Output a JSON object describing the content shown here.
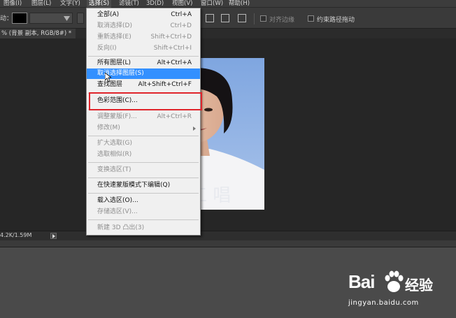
{
  "menubar": {
    "items": [
      {
        "label": "图像(I)"
      },
      {
        "label": "图层(L)"
      },
      {
        "label": "文字(Y)"
      },
      {
        "label": "选择(S)"
      },
      {
        "label": "滤镜(T)"
      },
      {
        "label": "3D(D)"
      },
      {
        "label": "视图(V)"
      },
      {
        "label": "窗口(W)"
      },
      {
        "label": "帮助(H)"
      }
    ]
  },
  "options": {
    "tool_label": "动：",
    "align_edges": "对齐边缘",
    "constrain_path": "约束路径拖动"
  },
  "document": {
    "tab_title": "% (背景 副本, RGB/8#) *",
    "close": "×",
    "size": "4.2K/1.59M"
  },
  "select_menu": {
    "items": [
      {
        "label": "全部(A)",
        "shortcut": "Ctrl+A",
        "enabled": true
      },
      {
        "label": "取消选择(D)",
        "shortcut": "Ctrl+D",
        "enabled": false
      },
      {
        "label": "重新选择(E)",
        "shortcut": "Shift+Ctrl+D",
        "enabled": false
      },
      {
        "label": "反向(I)",
        "shortcut": "Shift+Ctrl+I",
        "enabled": false
      },
      {
        "label": "所有图层(L)",
        "shortcut": "Alt+Ctrl+A",
        "enabled": true
      },
      {
        "label": "取消选择图层(S)",
        "shortcut": "",
        "enabled": true
      },
      {
        "label": "查找图层",
        "shortcut": "Alt+Shift+Ctrl+F",
        "enabled": true
      },
      {
        "label": "色彩范围(C)...",
        "shortcut": "",
        "enabled": true
      },
      {
        "label": "调整蒙版(F)...",
        "shortcut": "Alt+Ctrl+R",
        "enabled": false
      },
      {
        "label": "修改(M)",
        "shortcut": "",
        "enabled": false
      },
      {
        "label": "扩大选取(G)",
        "shortcut": "",
        "enabled": false
      },
      {
        "label": "选取相似(R)",
        "shortcut": "",
        "enabled": false
      },
      {
        "label": "变换选区(T)",
        "shortcut": "",
        "enabled": false
      },
      {
        "label": "在快速蒙版模式下编辑(Q)",
        "shortcut": "",
        "enabled": true
      },
      {
        "label": "载入选区(O)...",
        "shortcut": "",
        "enabled": true
      },
      {
        "label": "存储选区(V)...",
        "shortcut": "",
        "enabled": false
      },
      {
        "label": "新建 3D 凸出(3)",
        "shortcut": "",
        "enabled": false
      }
    ]
  },
  "watermark": {
    "brand": "Bai",
    "suffix": "经验",
    "url": "jingyan.baidu.com"
  },
  "colors": {
    "highlight": "#3390ff",
    "annotation_box": "#e0242b",
    "menu_bg": "#f0f0f0",
    "photo_bg": "#8fb0e3"
  }
}
